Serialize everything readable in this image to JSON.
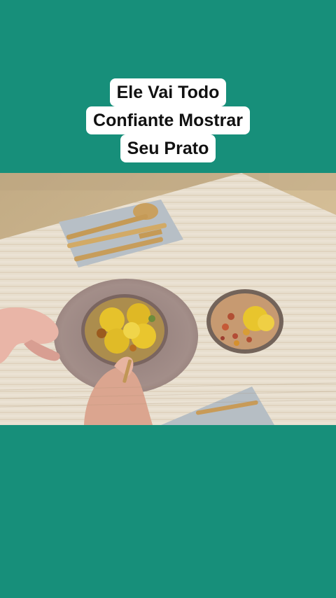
{
  "caption": {
    "lines": [
      "Ele Vai Todo",
      "Confiante Mostrar",
      "Seu Prato"
    ]
  },
  "video": {
    "description": "",
    "colors": {
      "background": "#178f7a",
      "table": "#c9b89b",
      "placemat": "#e6dccb",
      "napkin": "#b8c0c7",
      "plate": "#a58e88",
      "bowl_food": "#e8c52d"
    }
  }
}
